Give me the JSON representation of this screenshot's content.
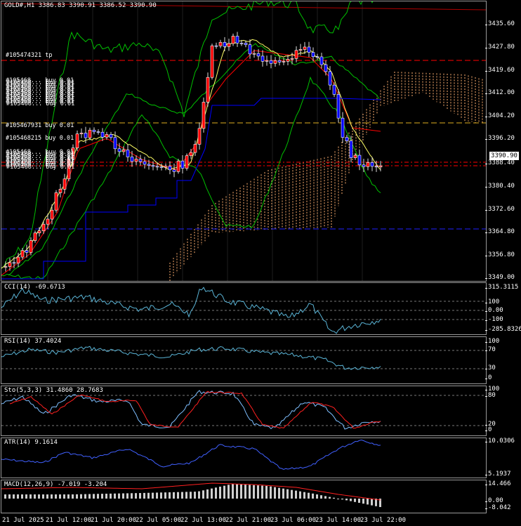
{
  "main": {
    "title": "GOLD#,H1  3386.83 3390.91 3386.52 3390.90",
    "price_labels": [
      "3435.60",
      "3427.80",
      "3419.60",
      "3412.00",
      "3404.20",
      "3396.20",
      "3388.40",
      "3380.40",
      "3372.60",
      "3364.80",
      "3356.80",
      "3349.00"
    ],
    "current_price": "3390.90",
    "order_labels": [
      "#105474321 tp",
      "#105467931 buy 0.01",
      "#105468215 buy 0.01"
    ],
    "stacked_label": "#105468... buy 0.01"
  },
  "cci": {
    "title": "CCI(14) -69.6713",
    "labels": [
      "315.3115",
      "100",
      "0.00",
      "-100",
      "-285.8326"
    ]
  },
  "rsi": {
    "title": "RSI(14) 37.4024",
    "labels": [
      "100",
      "70",
      "30",
      "0"
    ]
  },
  "stoch": {
    "title": "Sto(5,3,3) 31.4860 28.7683",
    "labels": [
      "100",
      "80",
      "20",
      "0"
    ]
  },
  "atr": {
    "title": "ATR(14) 9.1614",
    "labels": [
      "10.0306",
      "5.1937"
    ]
  },
  "macd": {
    "title": "MACD(12,26,9) -7.019 -3.204",
    "labels": [
      "14.466",
      "0.00",
      "-8.042"
    ]
  },
  "time_labels": [
    "21 Jul 2025",
    "21 Jul 12:00",
    "21 Jul 20:00",
    "22 Jul 05:00",
    "22 Jul 13:00",
    "22 Jul 21:00",
    "23 Jul 06:00",
    "23 Jul 14:00",
    "23 Jul 22:00"
  ],
  "colors": {
    "bg": "#000000",
    "bull": "#ff0000",
    "bear": "#0000ff",
    "ma_fast": "#ffff66",
    "ma_slow": "#ff0000",
    "kijun": "#0000ff",
    "bands": "#00c000",
    "cloud": "#ffb070",
    "level": "#ff0000",
    "osc": "#5ab4d6",
    "sig": "#ff2020"
  }
}
